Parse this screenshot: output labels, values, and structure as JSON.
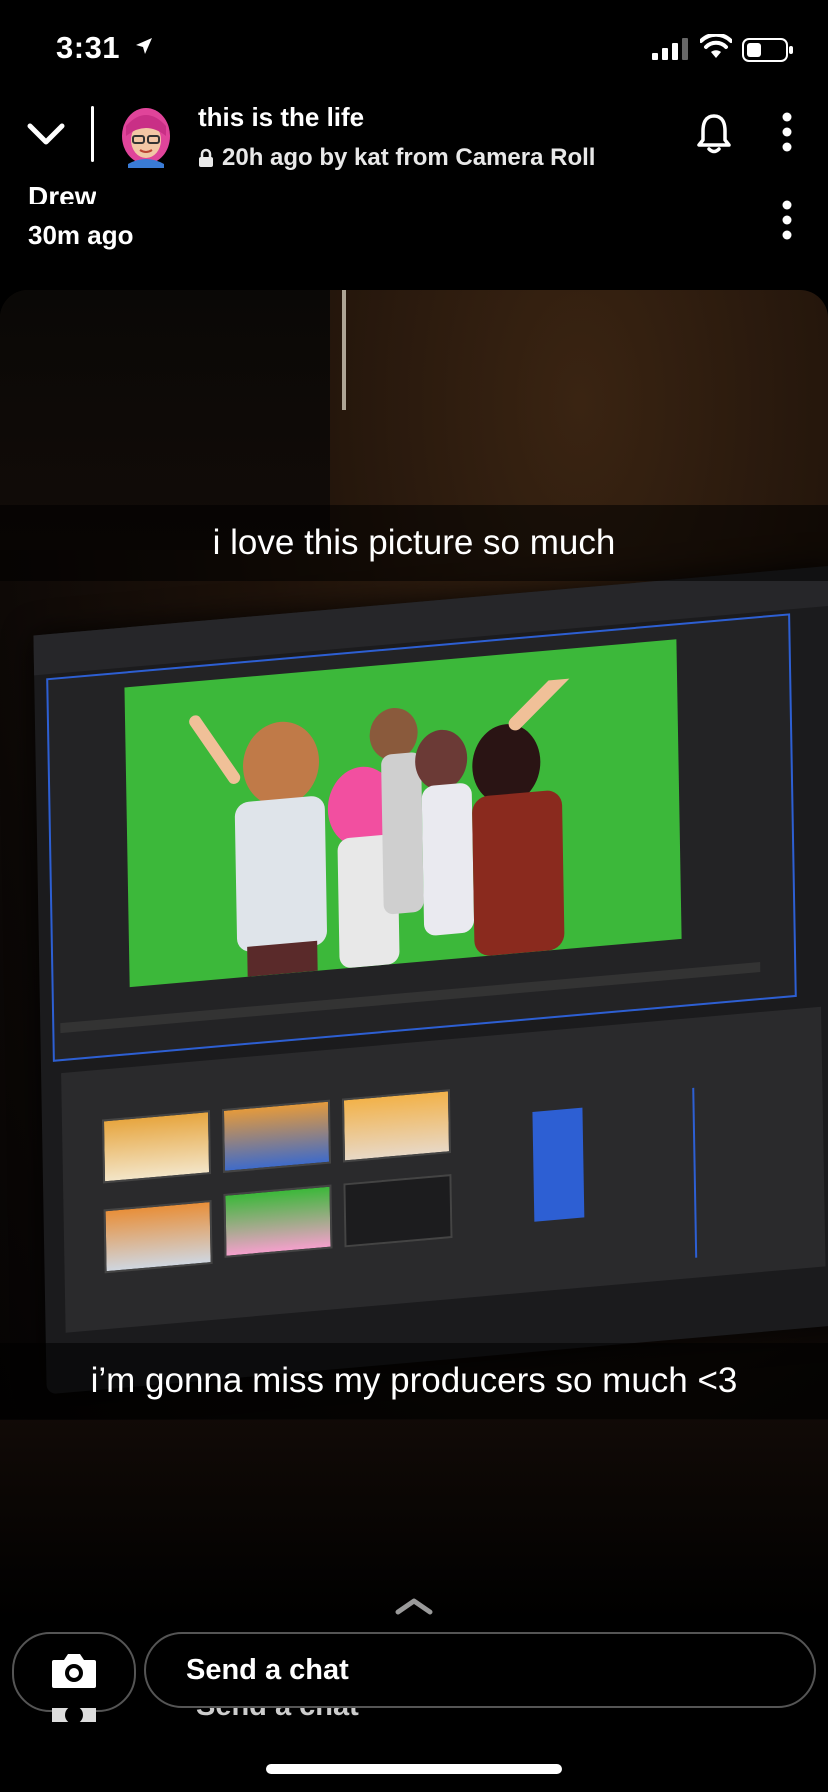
{
  "status_bar": {
    "time": "3:31"
  },
  "header": {
    "title": "this is the life",
    "meta": "20h ago by kat from Camera Roll"
  },
  "under_story": {
    "name": "Drew",
    "time": "30m ago"
  },
  "captions": [
    "i love this picture so much",
    "i’m gonna miss my producers so much <3"
  ],
  "chat": {
    "placeholder": "Send a chat",
    "ghost_placeholder": "Send a chat"
  },
  "colors": {
    "greenscreen": "#3cb83a",
    "selection_blue": "#2d5fd3"
  },
  "icons": {
    "back": "chevron-down-icon",
    "lock": "lock-icon",
    "bell": "bell-icon",
    "more": "more-vertical-icon",
    "camera": "camera-icon",
    "swipe_up": "chevron-up-icon"
  }
}
